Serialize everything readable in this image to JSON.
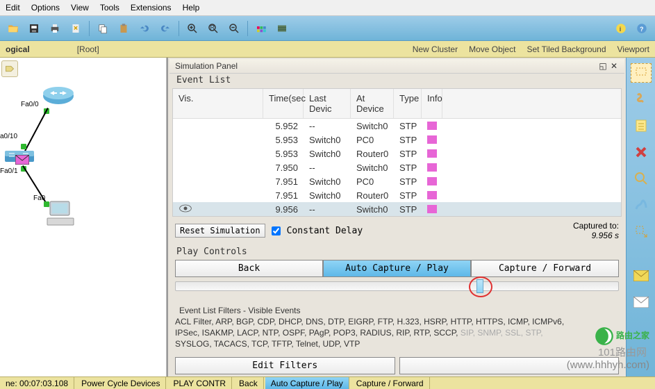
{
  "menu": {
    "items": [
      "Edit",
      "Options",
      "View",
      "Tools",
      "Extensions",
      "Help"
    ]
  },
  "toolbar_icons": [
    "open",
    "save",
    "print",
    "wizard",
    "|",
    "copy",
    "paste",
    "undo",
    "redo",
    "|",
    "zoom-in",
    "zoom-reset",
    "zoom-out",
    "|",
    "palette",
    "drawer",
    "|",
    "info",
    "help"
  ],
  "sub_toolbar": {
    "tab": "ogical",
    "root": "[Root]",
    "actions": [
      "New Cluster",
      "Move Object",
      "Set Tiled Background",
      "Viewport"
    ]
  },
  "topology": {
    "labels": {
      "fa00": "Fa0/0",
      "a010": "a0/10",
      "fa01": "Fa0/1",
      "fa0": "Fa0"
    }
  },
  "sim": {
    "title": "Simulation Panel",
    "sub": "Event List",
    "headers": {
      "vis": "Vis.",
      "time": "Time(sec",
      "last": "Last Devic",
      "at": "At Device",
      "type": "Type",
      "info": "Info"
    },
    "events": [
      {
        "time": "5.952",
        "last": "--",
        "at": "Switch0",
        "type": "STP",
        "color": "#e766d6"
      },
      {
        "time": "5.953",
        "last": "Switch0",
        "at": "PC0",
        "type": "STP",
        "color": "#e766d6"
      },
      {
        "time": "5.953",
        "last": "Switch0",
        "at": "Router0",
        "type": "STP",
        "color": "#e766d6"
      },
      {
        "time": "7.950",
        "last": "--",
        "at": "Switch0",
        "type": "STP",
        "color": "#e766d6"
      },
      {
        "time": "7.951",
        "last": "Switch0",
        "at": "PC0",
        "type": "STP",
        "color": "#e766d6"
      },
      {
        "time": "7.951",
        "last": "Switch0",
        "at": "Router0",
        "type": "STP",
        "color": "#e766d6"
      },
      {
        "time": "9.956",
        "last": "--",
        "at": "Switch0",
        "type": "STP",
        "color": "#e766d6",
        "selected": true,
        "eye": true
      }
    ],
    "reset": "Reset Simulation",
    "const_delay": "Constant Delay",
    "captured_lbl": "Captured to:",
    "captured_val": "9.956 s",
    "play_label": "Play Controls",
    "back": "Back",
    "auto": "Auto Capture / Play",
    "capfwd": "Capture / Forward",
    "filters_title": "Event List Filters - Visible Events",
    "filters_l1": "ACL Filter, ARP, BGP, CDP, DHCP, DNS, DTP, EIGRP, FTP, H.323, HSRP, HTTP, HTTPS, ICMP, ICMPv6,",
    "filters_l2": "IPSec, ISAKMP, LACP, NTP, OSPF, PAgP, POP3, RADIUS, RIP, RTP, SCCP, ",
    "filters_l2_grey": "SIP, SNMP, SSL, STP,",
    "filters_l3": "SYSLOG, TACACS, TCP, TFTP, Telnet, UDP, VTP",
    "edit_filters": "Edit Filters"
  },
  "bottom": {
    "time": "ne: 00:07:03.108",
    "items": [
      "Power Cycle Devices",
      "PLAY CONTR",
      "Back",
      "Auto Capture / Play",
      "Capture / Forward"
    ]
  },
  "watermark": {
    "text": "路由之家",
    "url": "(www.hhhyh.com)",
    "sub": "101路由网"
  }
}
